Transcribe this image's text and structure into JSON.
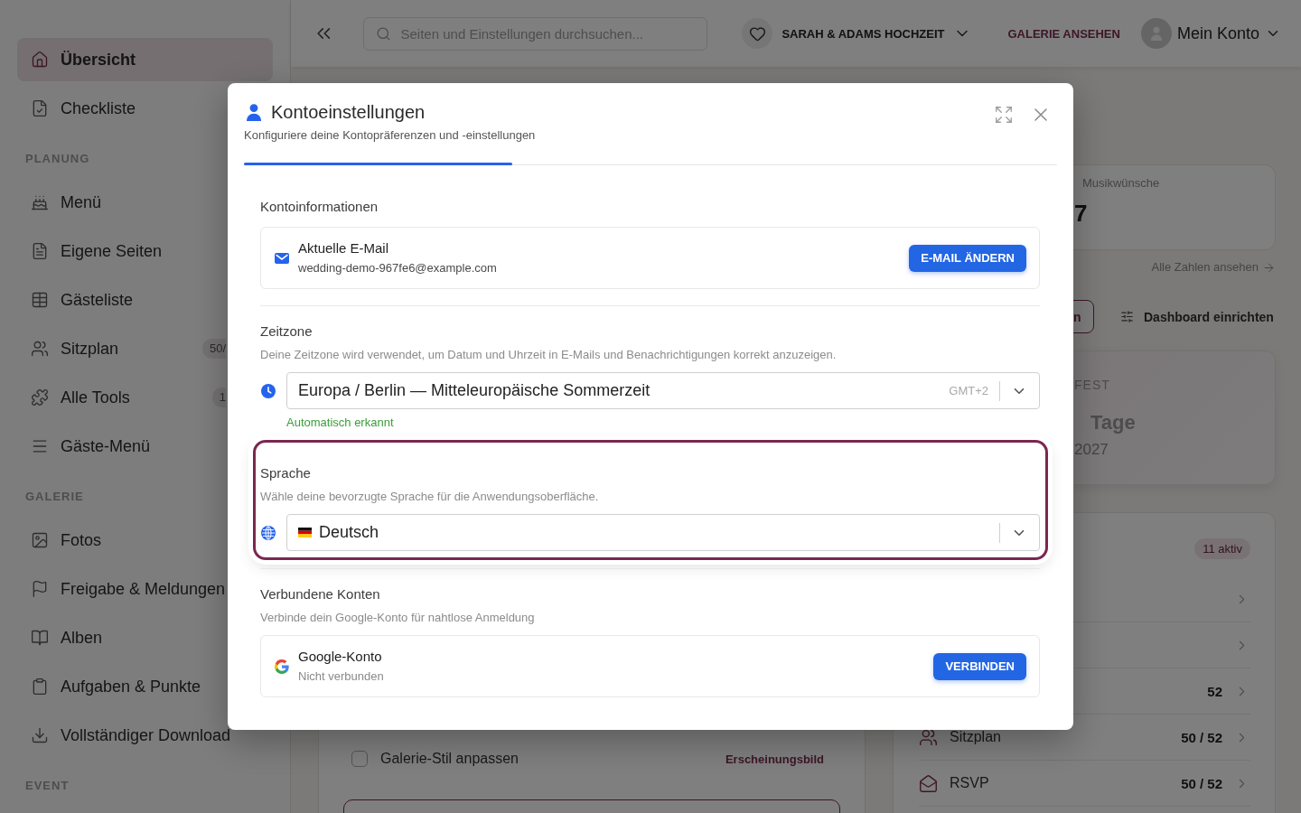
{
  "sidebar": {
    "sections": [
      {
        "items": [
          {
            "label": "Übersicht",
            "selected": true
          },
          {
            "label": "Checkliste",
            "selected": false
          }
        ]
      },
      {
        "heading": "PLANUNG",
        "items": [
          {
            "label": "Menü",
            "selected": false
          },
          {
            "label": "Eigene Seiten",
            "selected": false
          },
          {
            "label": "Gästeliste",
            "selected": false
          },
          {
            "label": "Sitzplan",
            "selected": false,
            "badge": "50/"
          },
          {
            "label": "Alle Tools",
            "selected": false,
            "badge": "1"
          },
          {
            "label": "Gäste-Menü",
            "selected": false
          }
        ]
      },
      {
        "heading": "GALERIE",
        "items": [
          {
            "label": "Fotos",
            "selected": false
          },
          {
            "label": "Freigabe & Meldungen",
            "selected": false
          },
          {
            "label": "Alben",
            "selected": false
          },
          {
            "label": "Aufgaben & Punkte",
            "selected": false
          },
          {
            "label": "Vollständiger Download",
            "selected": false
          }
        ]
      },
      {
        "heading": "EVENT"
      }
    ]
  },
  "topbar": {
    "search": {
      "placeholder": "Seiten und Einstellungen durchsuchen..."
    },
    "event": "SARAH & ADAMS HOCHZEIT",
    "gallery_link": "GALERIE ANSEHEN",
    "account": "Mein Konto"
  },
  "dashboard": {
    "stat": {
      "label": "Musikwünsche",
      "value": "7"
    },
    "stats_link": "Alle Zahlen ansehen",
    "actions": [
      {
        "kind": "outline",
        "label": "n"
      },
      {
        "kind": "plain",
        "label": "Dashboard einrichten"
      }
    ],
    "countdown": {
      "heading": "FEST",
      "unit": "Tage",
      "date": "2027"
    },
    "tools": {
      "badge": "11 aktiv",
      "rows": [
        {
          "kind": "link"
        },
        {
          "kind": "link"
        },
        {
          "kind": "link",
          "count": "52"
        },
        {
          "kind": "link",
          "label": "Sitzplan",
          "count": "50 / 52"
        },
        {
          "kind": "link",
          "label": "RSVP",
          "count": "50 / 52"
        }
      ]
    },
    "checklist": {
      "items": [
        {
          "label": "Galerie-Stil anpassen",
          "category": "Erscheinungsbild",
          "checked": false
        }
      ]
    }
  },
  "dialog": {
    "title": "Kontoeinstellungen",
    "subtitle": "Konfiguriere deine Kontopräferenzen und -einstellungen",
    "progress": {
      "level": 0.33
    },
    "sections": [
      {
        "kind": "card",
        "title": "Kontoinformationen",
        "highlighted": false,
        "card": {
          "kind": "email",
          "label": "Aktuelle E-Mail",
          "value": "wedding-demo-967fe6@example.com",
          "button": "E-MAIL ÄNDERN"
        }
      },
      {
        "kind": "select",
        "title": "Zeitzone",
        "description": "Deine Zeitzone wird verwendet, um Datum und Uhrzeit in E-Mails und Benachrichtigungen korrekt anzuzeigen.",
        "highlighted": false,
        "select": {
          "value": "Europa / Berlin — Mitteleuropäische Sommerzeit",
          "suffix": "GMT+2"
        },
        "hint": "Automatisch erkannt"
      },
      {
        "kind": "select",
        "title": "Sprache",
        "description": "Wähle deine bevorzugte Sprache für die Anwendungsoberfläche.",
        "highlighted": true,
        "select": {
          "value": "Deutsch"
        }
      },
      {
        "kind": "card",
        "title": "Verbundene Konten",
        "description": "Verbinde dein Google-Konto für nahtlose Anmeldung",
        "highlighted": false,
        "card": {
          "kind": "status",
          "label": "Google-Konto",
          "value": "Nicht verbunden",
          "button": "VERBINDEN"
        }
      }
    ]
  }
}
